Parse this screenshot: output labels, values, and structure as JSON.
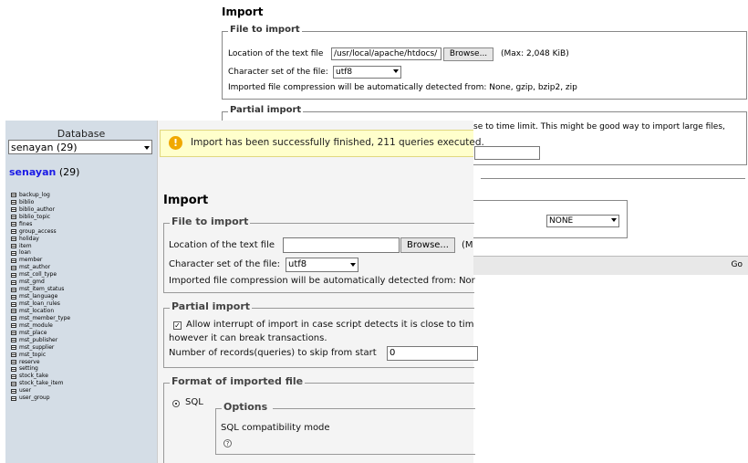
{
  "back_window": {
    "title": "Import",
    "file_to_import": {
      "legend": "File to import",
      "location_label": "Location of the text file",
      "location_value": "/usr/local/apache/htdocs/",
      "browse_label": "Browse...",
      "max_note": "(Max: 2,048 KiB)",
      "charset_label": "Character set of the file:",
      "charset_value": "utf8",
      "compression_note": "Imported file compression will be automatically detected from: None, gzip, bzip2, zip"
    },
    "partial_import": {
      "legend": "Partial import",
      "visible_text": "se to time limit. This might be good way to import large files,"
    },
    "compat_mode_value": "NONE",
    "go_label": "Go"
  },
  "sidebar": {
    "header": "Database",
    "db_select_value": "senayan (29)",
    "db_name": "senayan",
    "db_count": "(29)",
    "tables": [
      "backup_log",
      "biblio",
      "biblio_author",
      "biblio_topic",
      "fines",
      "group_access",
      "holiday",
      "item",
      "loan",
      "member",
      "mst_author",
      "mst_coll_type",
      "mst_gmd",
      "mst_item_status",
      "mst_language",
      "mst_loan_rules",
      "mst_location",
      "mst_member_type",
      "mst_module",
      "mst_place",
      "mst_publisher",
      "mst_supplier",
      "mst_topic",
      "reserve",
      "setting",
      "stock_take",
      "stock_take_item",
      "user",
      "user_group"
    ]
  },
  "front_window": {
    "notice": "Import has been successfully finished, 211 queries executed.",
    "title": "Import",
    "file_to_import": {
      "legend": "File to import",
      "location_label": "Location of the text file",
      "browse_label": "Browse...",
      "max_fragment": "(M",
      "charset_label": "Character set of the file:",
      "charset_value": "utf8",
      "compression_note": "Imported file compression will be automatically detected from: Nor"
    },
    "partial_import": {
      "legend": "Partial import",
      "allow_interrupt": "Allow interrupt of import in case script detects it is close to tim",
      "break_note": "however it can break transactions.",
      "skip_label": "Number of records(queries) to skip from start",
      "skip_value": "0"
    },
    "format": {
      "legend": "Format of imported file",
      "sql_label": "SQL",
      "options_legend": "Options",
      "compat_label": "SQL compatibility mode",
      "help_glyph": "?"
    }
  }
}
